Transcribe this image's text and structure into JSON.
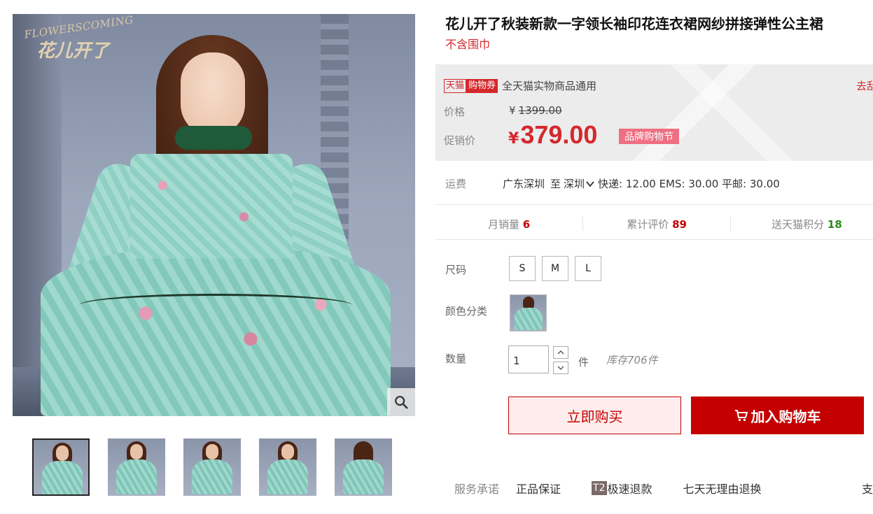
{
  "gallery": {
    "watermark_en": "FLOWERSCOMING",
    "watermark_zh": "花儿开了",
    "zoom_icon": "magnifier-icon",
    "thumbnails": [
      "thumb-1",
      "thumb-2",
      "thumb-3",
      "thumb-4",
      "thumb-5"
    ],
    "active_thumbnail": 0
  },
  "product": {
    "title": "花儿开了秋装新款一字领长袖印花连衣裙网纱拼接弹性公主裙",
    "subtitle": "不含围巾"
  },
  "price_panel": {
    "tmall_tag": "天猫",
    "coupon_tag": "购物券",
    "coupon_text": "全天猫实物商品通用",
    "coupon_link": "去刮",
    "original_label": "价格",
    "original_currency": "¥",
    "original_price": "1399.00",
    "promo_label": "促销价",
    "promo_currency": "¥",
    "promo_price": "379.00",
    "promo_tag": "品牌购物节",
    "accent_color": "#d4282d"
  },
  "shipping": {
    "label": "运费",
    "from": "广东深圳",
    "to_prefix": "至",
    "to": "深圳",
    "rates": "快递: 12.00 EMS: 30.00 平邮: 30.00"
  },
  "stats": {
    "monthly_sales_label": "月销量",
    "monthly_sales": "6",
    "reviews_label": "累计评价",
    "reviews": "89",
    "points_label": "送天猫积分",
    "points": "18"
  },
  "options": {
    "size_label": "尺码",
    "sizes": [
      "S",
      "M",
      "L"
    ],
    "color_label": "颜色分类",
    "quantity_label": "数量",
    "quantity": "1",
    "quantity_unit": "件",
    "stock": "库存706件"
  },
  "actions": {
    "buy_now": "立即购买",
    "add_to_cart": "加入购物车"
  },
  "services": {
    "label": "服务承诺",
    "items": [
      "正品保证",
      "极速退款",
      "七天无理由退换"
    ],
    "t2_badge": "T2",
    "more": "支"
  }
}
